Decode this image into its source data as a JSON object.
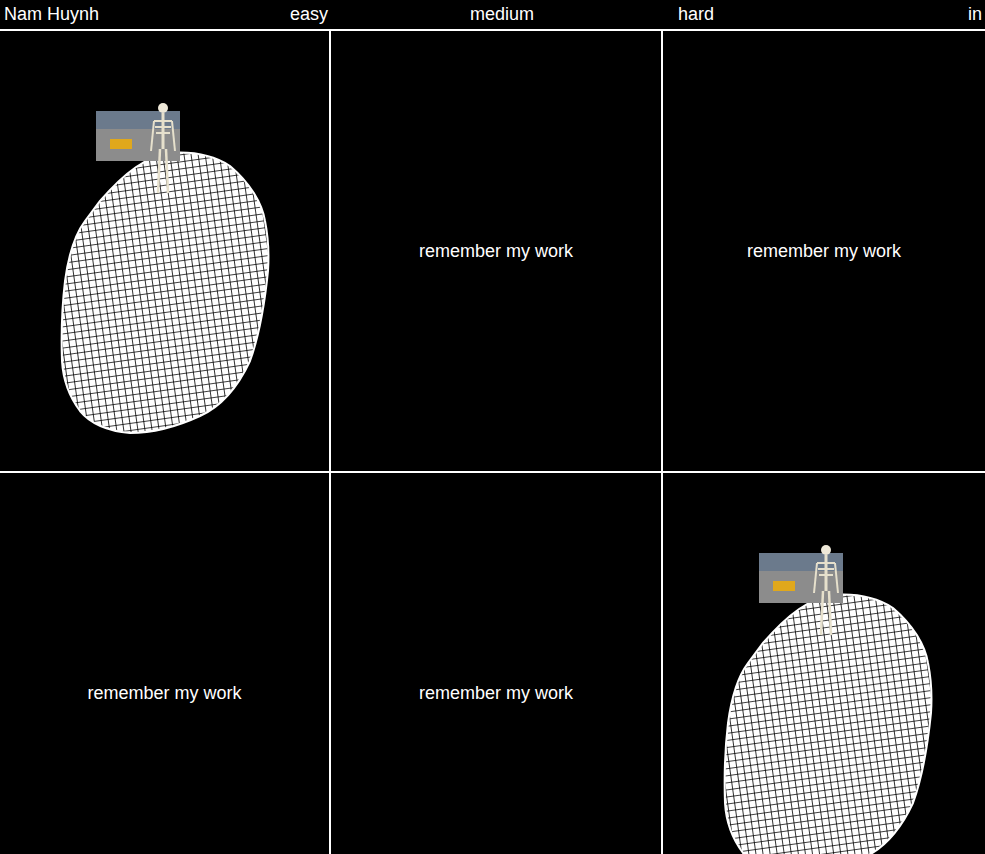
{
  "nav": {
    "items": [
      "Nam Huynh",
      "easy",
      "medium",
      "hard",
      "in"
    ]
  },
  "cells": [
    {
      "kind": "model"
    },
    {
      "kind": "text",
      "text": "remember my work"
    },
    {
      "kind": "text",
      "text": "remember my work"
    },
    {
      "kind": "text",
      "text": "remember my work"
    },
    {
      "kind": "text",
      "text": "remember my work"
    },
    {
      "kind": "model"
    }
  ]
}
